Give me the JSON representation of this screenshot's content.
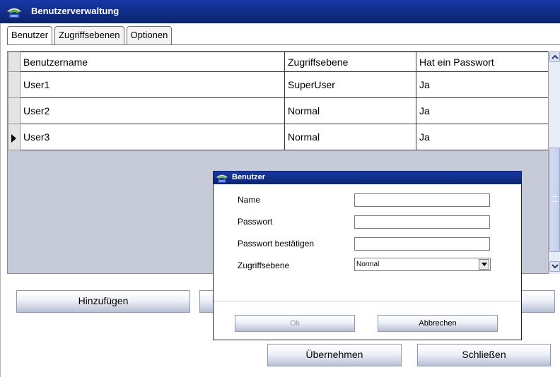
{
  "window": {
    "title": "Benutzerverwaltung"
  },
  "tabs": [
    {
      "label": "Benutzer",
      "active": true
    },
    {
      "label": "Zugriffsebenen",
      "active": false
    },
    {
      "label": "Optionen",
      "active": false
    }
  ],
  "grid": {
    "columns": [
      "Benutzername",
      "Zugriffsebene",
      "Hat ein Passwort"
    ],
    "rows": [
      {
        "name": "User1",
        "level": "SuperUser",
        "has_password": "Ja",
        "current": false
      },
      {
        "name": "User2",
        "level": "Normal",
        "has_password": "Ja",
        "current": false
      },
      {
        "name": "User3",
        "level": "Normal",
        "has_password": "Ja",
        "current": true
      }
    ]
  },
  "buttons": {
    "add": "Hinzufügen",
    "apply": "Übernehmen",
    "close": "Schließen"
  },
  "dialog": {
    "title": "Benutzer",
    "fields": {
      "name_label": "Name",
      "name_value": "",
      "password_label": "Passwort",
      "password_value": "",
      "confirm_label": "Passwort bestätigen",
      "confirm_value": "",
      "level_label": "Zugriffsebene",
      "level_value": "Normal"
    },
    "ok_label": "Ok",
    "ok_enabled": false,
    "cancel_label": "Abbrechen"
  },
  "colors": {
    "titlebar": "#0a246a",
    "grid_background": "#c7cbd9"
  }
}
